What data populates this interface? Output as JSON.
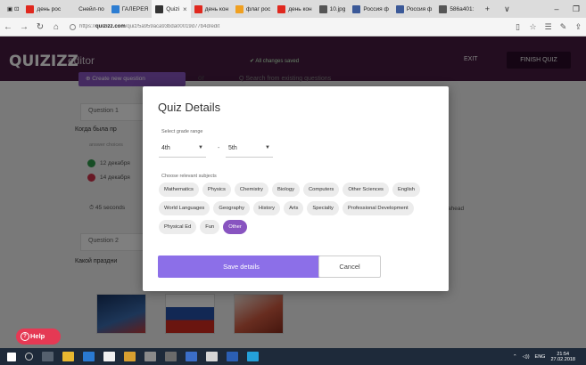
{
  "browser": {
    "tabs": [
      {
        "label": "день рос",
        "color": "#e0281e"
      },
      {
        "label": "Снейл-по",
        "color": "#dcdcdc"
      },
      {
        "label": "ГАЛЕРЕЯ",
        "color": "#2d7dd2"
      },
      {
        "label": "Quizi",
        "color": "#333333",
        "active": true
      },
      {
        "label": "день кон",
        "color": "#e0281e"
      },
      {
        "label": "флаг рос",
        "color": "#f0a020"
      },
      {
        "label": "день кон",
        "color": "#e0281e"
      },
      {
        "label": "10.jpg",
        "color": "#555555"
      },
      {
        "label": "Россия ф",
        "color": "#3b5998"
      },
      {
        "label": "Россия ф",
        "color": "#3b5998"
      },
      {
        "label": "586a401:",
        "color": "#555555"
      }
    ],
    "url_prefix": "https://",
    "url_domain": "quizizz.com",
    "url_path": "/quiz/5a959aca93bda00019d77b4d/edit"
  },
  "app": {
    "logo": "QUIZIZZ",
    "section": "editor",
    "status": "✔ All changes saved",
    "exit_label": "EXIT",
    "finish_label": "FINISH QUIZ"
  },
  "background": {
    "create_label": "⊕ Create new question",
    "or_label": "or",
    "search_label": "Q  Search from existing questions",
    "q1_header": "Question 1",
    "q1_text": "Когда была пр",
    "answer_choices": "answer choices",
    "ans1": "12 декабря",
    "ans2": "14 декабря",
    "time": "⏱ 45 seconds",
    "q2_header": "Question 2",
    "q2_text": "Какой праздни",
    "side_label": "ahead"
  },
  "modal": {
    "title": "Quiz Details",
    "grade_label": "Select grade range",
    "grade_from": "4th",
    "grade_to": "5th",
    "subjects_label": "Choose relevant subjects",
    "subjects": [
      {
        "label": "Mathematics",
        "selected": false
      },
      {
        "label": "Physics",
        "selected": false
      },
      {
        "label": "Chemistry",
        "selected": false
      },
      {
        "label": "Biology",
        "selected": false
      },
      {
        "label": "Computers",
        "selected": false
      },
      {
        "label": "Other Sciences",
        "selected": false
      },
      {
        "label": "English",
        "selected": false
      },
      {
        "label": "World Languages",
        "selected": false
      },
      {
        "label": "Geography",
        "selected": false
      },
      {
        "label": "History",
        "selected": false
      },
      {
        "label": "Arts",
        "selected": false
      },
      {
        "label": "Specialty",
        "selected": false
      },
      {
        "label": "Professional Development",
        "selected": false
      },
      {
        "label": "Physical Ed",
        "selected": false
      },
      {
        "label": "Fun",
        "selected": false
      },
      {
        "label": "Other",
        "selected": true
      }
    ],
    "save_label": "Save details",
    "cancel_label": "Cancel"
  },
  "help_label": "Help",
  "taskbar": {
    "lang": "ENG",
    "time": "21:54",
    "date": "27.02.2018"
  }
}
